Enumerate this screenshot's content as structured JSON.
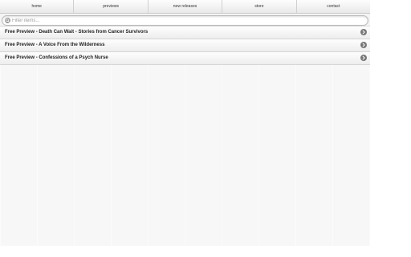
{
  "nav": {
    "items": [
      {
        "label": "home"
      },
      {
        "label": "previews"
      },
      {
        "label": "new releases"
      },
      {
        "label": "store"
      },
      {
        "label": "contact"
      }
    ]
  },
  "filter": {
    "placeholder": "Filter items...",
    "icon": "search-icon"
  },
  "list": {
    "items": [
      {
        "label": "Free Preview - Death Can Wait - Stories from Cancer Survivors",
        "icon": "chevron-right-icon"
      },
      {
        "label": "Free Preview - A Voice From the Wilderness",
        "icon": "chevron-right-icon"
      },
      {
        "label": "Free Preview - Confessions of a Psych Nurse",
        "icon": "chevron-right-icon"
      }
    ]
  },
  "colors": {
    "background": "#f7f7f7",
    "arrow_bg": "#777777",
    "text": "#222222"
  }
}
